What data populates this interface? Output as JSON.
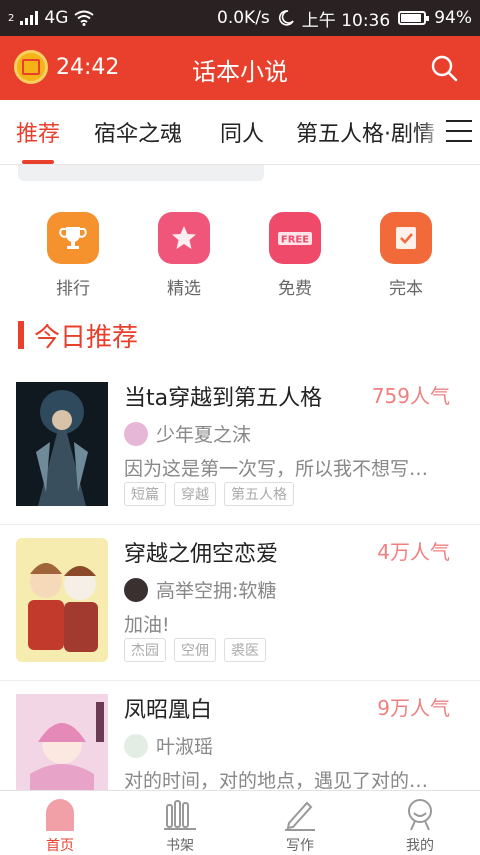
{
  "statusbar": {
    "network": "4G",
    "sim": "2",
    "speed": "0.0K/s",
    "time": "上午 10:36",
    "battery": "94%"
  },
  "header": {
    "timer": "24:42",
    "title": "话本小说"
  },
  "tabs": [
    {
      "label": "推荐"
    },
    {
      "label": "宿伞之魂"
    },
    {
      "label": "同人"
    },
    {
      "label": "第五人格·剧情"
    }
  ],
  "quick_links": [
    {
      "label": "排行",
      "icon": "trophy-icon",
      "color": "#f5922d"
    },
    {
      "label": "精选",
      "icon": "star-icon",
      "color": "#f0557a"
    },
    {
      "label": "免费",
      "icon": "free-icon",
      "color": "#f04a6a"
    },
    {
      "label": "完本",
      "icon": "check-icon",
      "color": "#f26a3a"
    }
  ],
  "section": {
    "title": "今日推荐"
  },
  "books": [
    {
      "title": "当ta穿越到第五人格",
      "popularity": "759人气",
      "author": "少年夏之沫",
      "desc": "因为这是第一次写，所以我不想写…",
      "tags": [
        "短篇",
        "穿越",
        "第五人格"
      ]
    },
    {
      "title": "穿越之佣空恋爱",
      "popularity": "4万人气",
      "author": "高举空拥:软糖",
      "desc": "加油!",
      "tags": [
        "杰园",
        "空佣",
        "裘医"
      ]
    },
    {
      "title": "凤昭凰白",
      "popularity": "9万人气",
      "author": "叶淑瑶",
      "desc": "对的时间，对的地点，遇见了对的…",
      "tags": []
    }
  ],
  "bottom_nav": [
    {
      "label": "首页",
      "icon": "home-icon"
    },
    {
      "label": "书架",
      "icon": "bookshelf-icon"
    },
    {
      "label": "写作",
      "icon": "pen-icon"
    },
    {
      "label": "我的",
      "icon": "profile-icon"
    }
  ],
  "colors": {
    "accent": "#e8402d",
    "popularity": "#f08080"
  }
}
